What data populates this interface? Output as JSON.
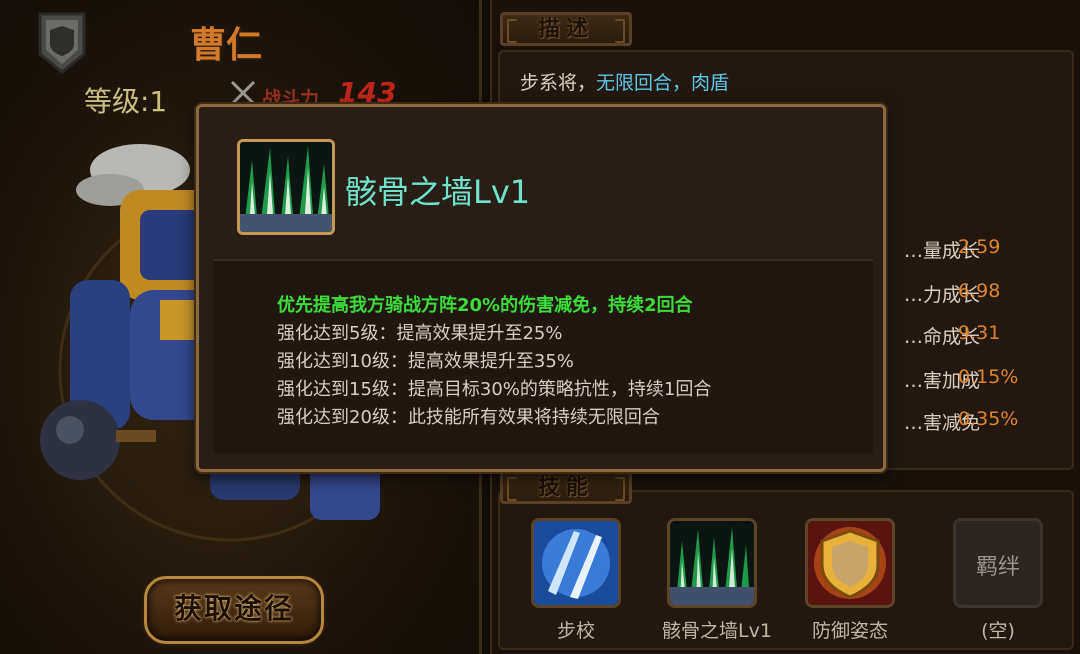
{
  "hero": {
    "name": "曹仁",
    "level_text": "等级:1",
    "power_label": "战斗力",
    "power_value": "143"
  },
  "acquire_button": "获取途径",
  "description": {
    "tab_label": "描述",
    "line1_prefix": "步系将，",
    "line1_highlight": "无限回合，肉盾"
  },
  "stats": [
    {
      "label": "…量成长",
      "value": "2.59"
    },
    {
      "label": "…力成长",
      "value": "6.98"
    },
    {
      "label": "…命成长",
      "value": "9.31"
    },
    {
      "label": "…害加成",
      "value": "0.15%"
    },
    {
      "label": "…害减免",
      "value": "0.35%"
    }
  ],
  "skills_section": {
    "tab_label": "技能",
    "items": [
      {
        "name": "步校"
      },
      {
        "name": "骸骨之墙Lv1"
      },
      {
        "name": "防御姿态"
      },
      {
        "name": "(空)",
        "empty_label": "羁绊"
      }
    ]
  },
  "popup": {
    "title": "骸骨之墙Lv1",
    "lines": [
      "优先提高我方骑战方阵20%的伤害减免，持续2回合",
      "强化达到5级：提高效果提升至25%",
      "强化达到10级：提高效果提升至35%",
      "强化达到15级：提高目标30%的策略抗性，持续1回合",
      "强化达到20级：此技能所有效果将持续无限回合"
    ]
  },
  "colors": {
    "highlight_cyan": "#5fc6e8",
    "popup_first_line": "#3ddc3a",
    "stat_value": "#e0832c",
    "hero_name": "#d27a2a"
  }
}
